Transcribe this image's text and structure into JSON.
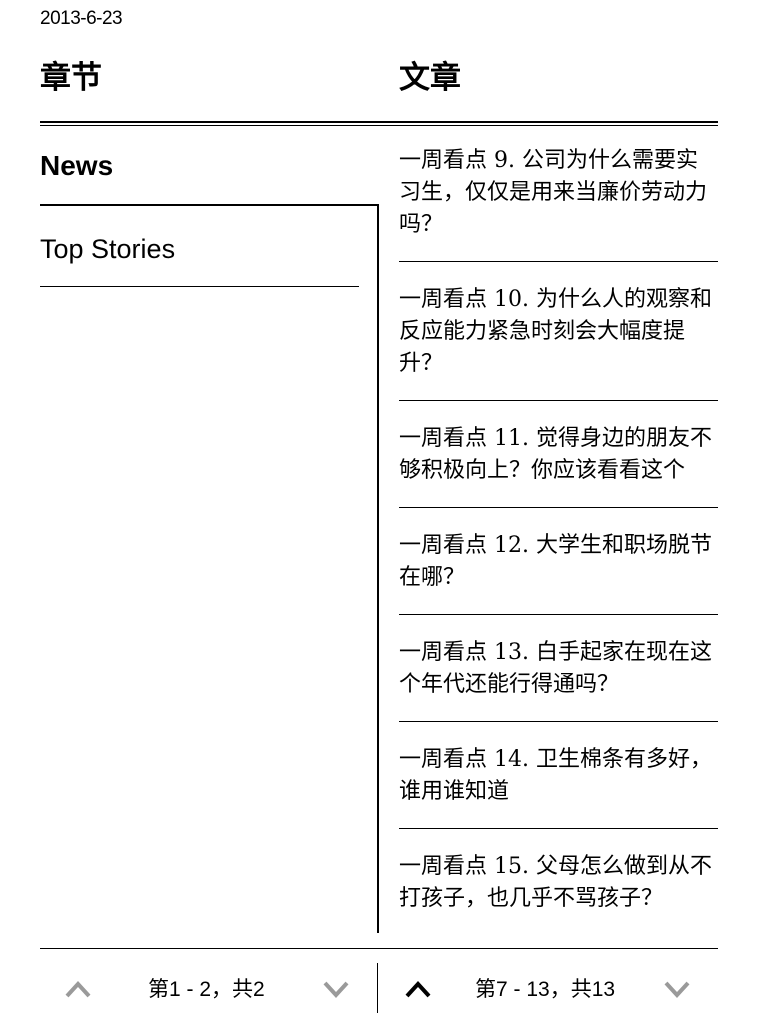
{
  "date": "2013-6-23",
  "headers": {
    "chapters": "章节",
    "articles": "文章"
  },
  "chapters": [
    {
      "label": "News",
      "selected": true
    },
    {
      "label": "Top Stories",
      "selected": false
    }
  ],
  "articles": [
    "一周看点 9. 公司为什么需要实习生，仅仅是用来当廉价劳动力吗？",
    "一周看点 10. 为什么人的观察和反应能力紧急时刻会大幅度提升？",
    "一周看点 11. 觉得身边的朋友不够积极向上？你应该看看这个",
    "一周看点 12. 大学生和职场脱节在哪？",
    "一周看点 13. 白手起家在现在这个年代还能行得通吗？",
    "一周看点 14. 卫生棉条有多好，谁用谁知道",
    "一周看点 15. 父母怎么做到从不打孩子，也几乎不骂孩子？"
  ],
  "pager": {
    "left": "第1 - 2，共2",
    "right": "第7 - 13，共13"
  },
  "icons": {
    "prev": "chevron-up-icon",
    "next": "chevron-down-icon"
  },
  "colors": {
    "active": "#000000",
    "inactive": "#9a9a9a"
  }
}
